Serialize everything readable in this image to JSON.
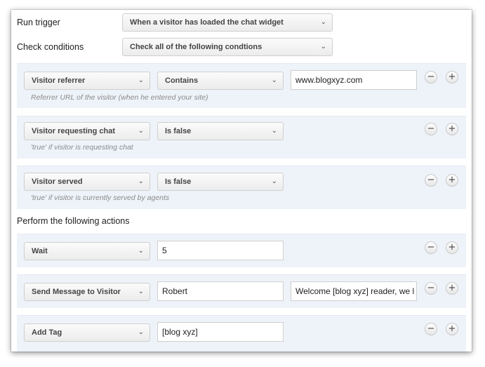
{
  "trigger": {
    "label": "Run trigger",
    "value": "When a visitor has loaded the chat widget"
  },
  "conditions_mode": {
    "label": "Check conditions",
    "value": "Check all of the following condtions"
  },
  "conditions": [
    {
      "field": "Visitor referrer",
      "operator": "Contains",
      "value": "www.blogxyz.com",
      "hint": "Referrer URL of the visitor (when he entered your site)"
    },
    {
      "field": "Visitor requesting chat",
      "operator": "Is false",
      "hint": "'true' if visitor is requesting chat"
    },
    {
      "field": "Visitor served",
      "operator": "Is false",
      "hint": "'true' if visitor is currently served by agents"
    }
  ],
  "actions_label": "Perform the following actions",
  "actions": [
    {
      "type": "Wait",
      "value": "5"
    },
    {
      "type": "Send Message to Visitor",
      "value": "Robert",
      "message": "Welcome [blog xyz] reader, we l"
    },
    {
      "type": "Add Tag",
      "value": "[blog xyz]"
    }
  ],
  "icons": {
    "remove": "minus-icon",
    "add": "plus-icon",
    "dropdown": "chevron-down-icon"
  }
}
